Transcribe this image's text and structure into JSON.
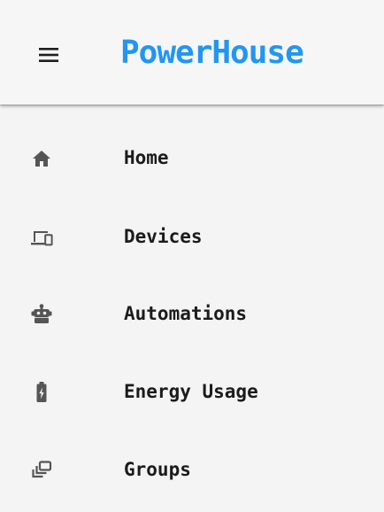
{
  "colors": {
    "brand": "#2196f3",
    "icon": "#555555",
    "label": "#1b1b1b",
    "background": "#f4f4f4"
  },
  "header": {
    "title": "PowerHouse",
    "menu_icon": "hamburger-menu-icon"
  },
  "nav": {
    "items": [
      {
        "label": "Home",
        "icon": "home-icon"
      },
      {
        "label": "Devices",
        "icon": "devices-icon"
      },
      {
        "label": "Automations",
        "icon": "robot-icon"
      },
      {
        "label": "Energy Usage",
        "icon": "battery-charging-icon"
      },
      {
        "label": "Groups",
        "icon": "group-icon"
      }
    ]
  }
}
